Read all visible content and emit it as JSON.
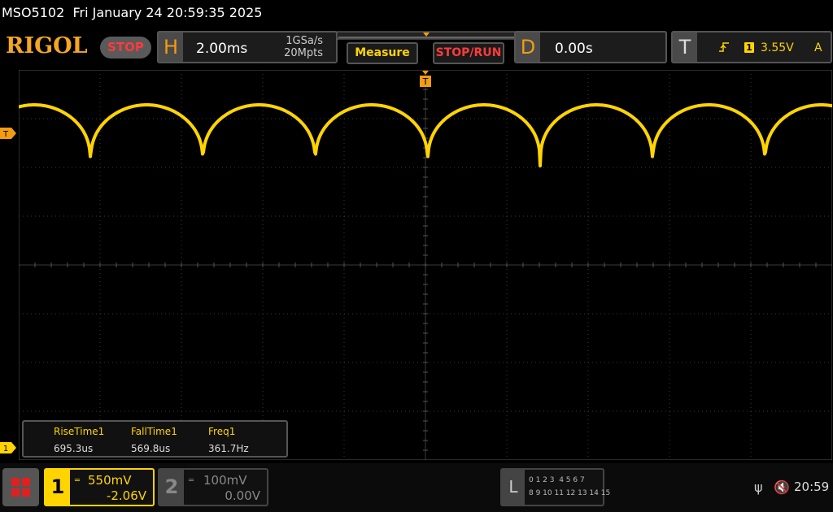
{
  "title_bar": {
    "model": "MSO5102",
    "datetime": "Fri January 24 20:59:35 2025"
  },
  "brand": {
    "logo": "RIGOL",
    "run_state": "STOP"
  },
  "horizontal": {
    "letter": "H",
    "timebase": "2.00ms",
    "sample_rate": "1GSa/s",
    "memory_depth": "20Mpts"
  },
  "buttons": {
    "measure": "Measure",
    "stop_run": "STOP/RUN"
  },
  "delay": {
    "letter": "D",
    "value": "0.00s"
  },
  "trigger": {
    "letter": "T",
    "slope_icon": "rising-edge-icon",
    "channel": "1",
    "level": "3.55V",
    "coupling": "A",
    "marker": "T"
  },
  "measurements": [
    {
      "label": "RiseTime1",
      "value": "695.3us"
    },
    {
      "label": "FallTime1",
      "value": "569.8us"
    },
    {
      "label": "Freq1",
      "value": "361.7Hz"
    }
  ],
  "channels": [
    {
      "number": "1",
      "scale": "550mV",
      "offset": "-2.06V",
      "color": "#ffd400",
      "active": true
    },
    {
      "number": "2",
      "scale": "100mV",
      "offset": "0.00V",
      "color": "#888888",
      "active": false
    }
  ],
  "logic_analyzer": {
    "letter": "L",
    "row1": "0 1 2 3  4 5 6 7",
    "row2": "8 9 10 11 12 13 14 15"
  },
  "status": {
    "time": "20:59",
    "usb_icon": "usb-icon",
    "sound_icon": "mute-icon"
  },
  "colors": {
    "ch1": "#ffd400",
    "accent": "#f39c12",
    "stop": "#ff3b3b",
    "grid": "#3a3a3a"
  }
}
